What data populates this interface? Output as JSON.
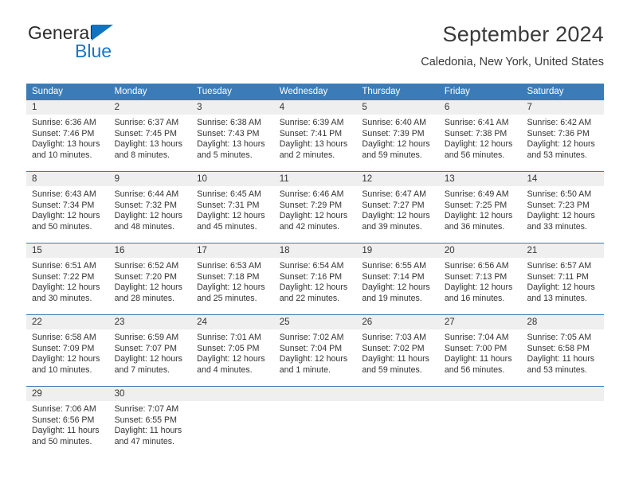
{
  "logo": {
    "name_part1": "General",
    "name_part2": "Blue",
    "triangle_color": "#1274c0",
    "blue_color": "#1576c8"
  },
  "header": {
    "title": "September 2024",
    "location": "Caledonia, New York, United States"
  },
  "theme": {
    "header_bar_color": "#3b7cb8",
    "day_strip_color": "#efefef",
    "separator_color": "#3b7cb8",
    "text_color": "#333333"
  },
  "weekdays": [
    "Sunday",
    "Monday",
    "Tuesday",
    "Wednesday",
    "Thursday",
    "Friday",
    "Saturday"
  ],
  "weeks": [
    [
      {
        "day": "1",
        "sunrise": "Sunrise: 6:36 AM",
        "sunset": "Sunset: 7:46 PM",
        "daylight1": "Daylight: 13 hours",
        "daylight2": "and 10 minutes."
      },
      {
        "day": "2",
        "sunrise": "Sunrise: 6:37 AM",
        "sunset": "Sunset: 7:45 PM",
        "daylight1": "Daylight: 13 hours",
        "daylight2": "and 8 minutes."
      },
      {
        "day": "3",
        "sunrise": "Sunrise: 6:38 AM",
        "sunset": "Sunset: 7:43 PM",
        "daylight1": "Daylight: 13 hours",
        "daylight2": "and 5 minutes."
      },
      {
        "day": "4",
        "sunrise": "Sunrise: 6:39 AM",
        "sunset": "Sunset: 7:41 PM",
        "daylight1": "Daylight: 13 hours",
        "daylight2": "and 2 minutes."
      },
      {
        "day": "5",
        "sunrise": "Sunrise: 6:40 AM",
        "sunset": "Sunset: 7:39 PM",
        "daylight1": "Daylight: 12 hours",
        "daylight2": "and 59 minutes."
      },
      {
        "day": "6",
        "sunrise": "Sunrise: 6:41 AM",
        "sunset": "Sunset: 7:38 PM",
        "daylight1": "Daylight: 12 hours",
        "daylight2": "and 56 minutes."
      },
      {
        "day": "7",
        "sunrise": "Sunrise: 6:42 AM",
        "sunset": "Sunset: 7:36 PM",
        "daylight1": "Daylight: 12 hours",
        "daylight2": "and 53 minutes."
      }
    ],
    [
      {
        "day": "8",
        "sunrise": "Sunrise: 6:43 AM",
        "sunset": "Sunset: 7:34 PM",
        "daylight1": "Daylight: 12 hours",
        "daylight2": "and 50 minutes."
      },
      {
        "day": "9",
        "sunrise": "Sunrise: 6:44 AM",
        "sunset": "Sunset: 7:32 PM",
        "daylight1": "Daylight: 12 hours",
        "daylight2": "and 48 minutes."
      },
      {
        "day": "10",
        "sunrise": "Sunrise: 6:45 AM",
        "sunset": "Sunset: 7:31 PM",
        "daylight1": "Daylight: 12 hours",
        "daylight2": "and 45 minutes."
      },
      {
        "day": "11",
        "sunrise": "Sunrise: 6:46 AM",
        "sunset": "Sunset: 7:29 PM",
        "daylight1": "Daylight: 12 hours",
        "daylight2": "and 42 minutes."
      },
      {
        "day": "12",
        "sunrise": "Sunrise: 6:47 AM",
        "sunset": "Sunset: 7:27 PM",
        "daylight1": "Daylight: 12 hours",
        "daylight2": "and 39 minutes."
      },
      {
        "day": "13",
        "sunrise": "Sunrise: 6:49 AM",
        "sunset": "Sunset: 7:25 PM",
        "daylight1": "Daylight: 12 hours",
        "daylight2": "and 36 minutes."
      },
      {
        "day": "14",
        "sunrise": "Sunrise: 6:50 AM",
        "sunset": "Sunset: 7:23 PM",
        "daylight1": "Daylight: 12 hours",
        "daylight2": "and 33 minutes."
      }
    ],
    [
      {
        "day": "15",
        "sunrise": "Sunrise: 6:51 AM",
        "sunset": "Sunset: 7:22 PM",
        "daylight1": "Daylight: 12 hours",
        "daylight2": "and 30 minutes."
      },
      {
        "day": "16",
        "sunrise": "Sunrise: 6:52 AM",
        "sunset": "Sunset: 7:20 PM",
        "daylight1": "Daylight: 12 hours",
        "daylight2": "and 28 minutes."
      },
      {
        "day": "17",
        "sunrise": "Sunrise: 6:53 AM",
        "sunset": "Sunset: 7:18 PM",
        "daylight1": "Daylight: 12 hours",
        "daylight2": "and 25 minutes."
      },
      {
        "day": "18",
        "sunrise": "Sunrise: 6:54 AM",
        "sunset": "Sunset: 7:16 PM",
        "daylight1": "Daylight: 12 hours",
        "daylight2": "and 22 minutes."
      },
      {
        "day": "19",
        "sunrise": "Sunrise: 6:55 AM",
        "sunset": "Sunset: 7:14 PM",
        "daylight1": "Daylight: 12 hours",
        "daylight2": "and 19 minutes."
      },
      {
        "day": "20",
        "sunrise": "Sunrise: 6:56 AM",
        "sunset": "Sunset: 7:13 PM",
        "daylight1": "Daylight: 12 hours",
        "daylight2": "and 16 minutes."
      },
      {
        "day": "21",
        "sunrise": "Sunrise: 6:57 AM",
        "sunset": "Sunset: 7:11 PM",
        "daylight1": "Daylight: 12 hours",
        "daylight2": "and 13 minutes."
      }
    ],
    [
      {
        "day": "22",
        "sunrise": "Sunrise: 6:58 AM",
        "sunset": "Sunset: 7:09 PM",
        "daylight1": "Daylight: 12 hours",
        "daylight2": "and 10 minutes."
      },
      {
        "day": "23",
        "sunrise": "Sunrise: 6:59 AM",
        "sunset": "Sunset: 7:07 PM",
        "daylight1": "Daylight: 12 hours",
        "daylight2": "and 7 minutes."
      },
      {
        "day": "24",
        "sunrise": "Sunrise: 7:01 AM",
        "sunset": "Sunset: 7:05 PM",
        "daylight1": "Daylight: 12 hours",
        "daylight2": "and 4 minutes."
      },
      {
        "day": "25",
        "sunrise": "Sunrise: 7:02 AM",
        "sunset": "Sunset: 7:04 PM",
        "daylight1": "Daylight: 12 hours",
        "daylight2": "and 1 minute."
      },
      {
        "day": "26",
        "sunrise": "Sunrise: 7:03 AM",
        "sunset": "Sunset: 7:02 PM",
        "daylight1": "Daylight: 11 hours",
        "daylight2": "and 59 minutes."
      },
      {
        "day": "27",
        "sunrise": "Sunrise: 7:04 AM",
        "sunset": "Sunset: 7:00 PM",
        "daylight1": "Daylight: 11 hours",
        "daylight2": "and 56 minutes."
      },
      {
        "day": "28",
        "sunrise": "Sunrise: 7:05 AM",
        "sunset": "Sunset: 6:58 PM",
        "daylight1": "Daylight: 11 hours",
        "daylight2": "and 53 minutes."
      }
    ],
    [
      {
        "day": "29",
        "sunrise": "Sunrise: 7:06 AM",
        "sunset": "Sunset: 6:56 PM",
        "daylight1": "Daylight: 11 hours",
        "daylight2": "and 50 minutes."
      },
      {
        "day": "30",
        "sunrise": "Sunrise: 7:07 AM",
        "sunset": "Sunset: 6:55 PM",
        "daylight1": "Daylight: 11 hours",
        "daylight2": "and 47 minutes."
      },
      {
        "day": "",
        "sunrise": "",
        "sunset": "",
        "daylight1": "",
        "daylight2": ""
      },
      {
        "day": "",
        "sunrise": "",
        "sunset": "",
        "daylight1": "",
        "daylight2": ""
      },
      {
        "day": "",
        "sunrise": "",
        "sunset": "",
        "daylight1": "",
        "daylight2": ""
      },
      {
        "day": "",
        "sunrise": "",
        "sunset": "",
        "daylight1": "",
        "daylight2": ""
      },
      {
        "day": "",
        "sunrise": "",
        "sunset": "",
        "daylight1": "",
        "daylight2": ""
      }
    ]
  ]
}
